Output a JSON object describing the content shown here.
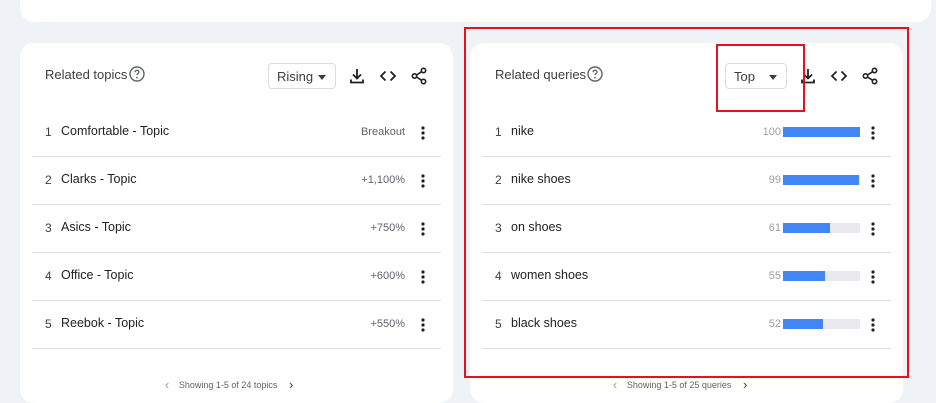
{
  "related_topics": {
    "title": "Related topics",
    "filter": "Rising",
    "rows": [
      {
        "rank": "1",
        "label": "Comfortable - Topic",
        "metric": "Breakout"
      },
      {
        "rank": "2",
        "label": "Clarks - Topic",
        "metric": "+1,100%"
      },
      {
        "rank": "3",
        "label": "Asics - Topic",
        "metric": "+750%"
      },
      {
        "rank": "4",
        "label": "Office - Topic",
        "metric": "+600%"
      },
      {
        "rank": "5",
        "label": "Reebok - Topic",
        "metric": "+550%"
      }
    ],
    "pager": "Showing 1-5 of 24 topics"
  },
  "related_queries": {
    "title": "Related queries",
    "filter": "Top",
    "rows": [
      {
        "rank": "1",
        "label": "nike",
        "score": "100",
        "value": 100
      },
      {
        "rank": "2",
        "label": "nike shoes",
        "score": "99",
        "value": 99
      },
      {
        "rank": "3",
        "label": "on shoes",
        "score": "61",
        "value": 61
      },
      {
        "rank": "4",
        "label": "women shoes",
        "score": "55",
        "value": 55
      },
      {
        "rank": "5",
        "label": "black shoes",
        "score": "52",
        "value": 52
      }
    ],
    "pager": "Showing 1-5 of 25 queries"
  },
  "colors": {
    "bar": "#4285f4",
    "bar_track": "#e8eaed",
    "highlight": "#e8101a"
  },
  "icons": {
    "help": "help-circle-icon",
    "download": "download-icon",
    "embed": "code-icon",
    "share": "share-icon",
    "more": "more-vert-icon",
    "prev": "chevron-left-icon",
    "next": "chevron-right-icon"
  }
}
